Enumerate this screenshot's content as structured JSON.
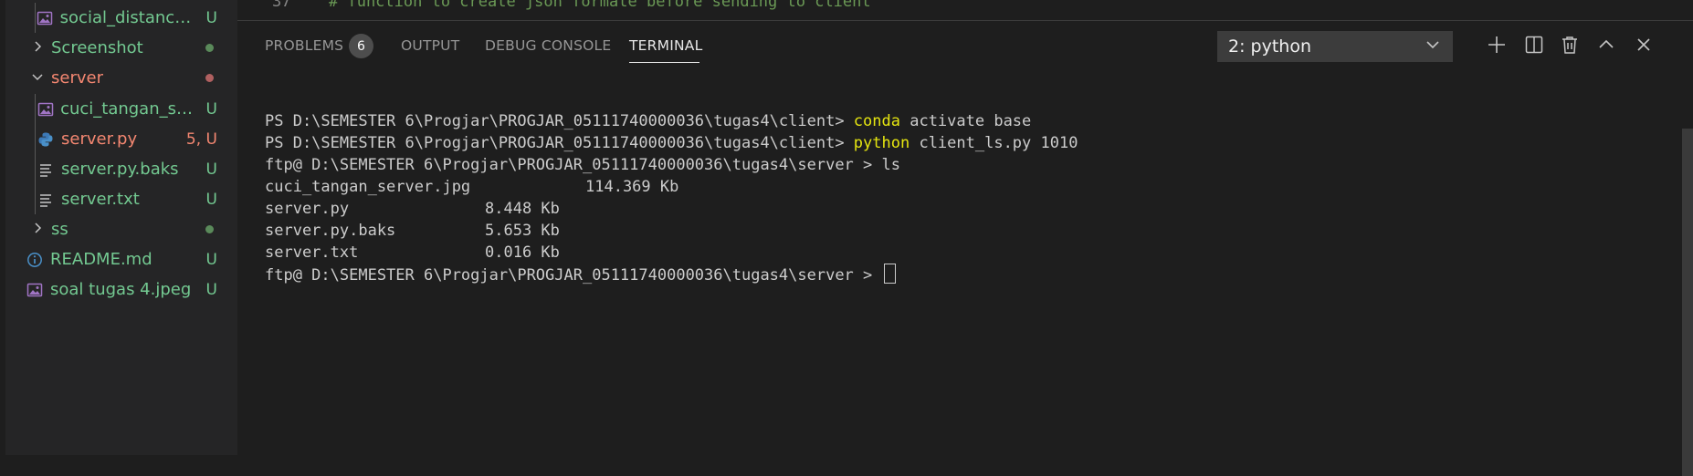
{
  "explorer": {
    "items": [
      {
        "label": "social_distancin...",
        "badge": "U",
        "type": "image",
        "color": "#73c991"
      },
      {
        "label": "Screenshot",
        "badge": "",
        "type": "folder-collapsed",
        "dot": "#5a8a5a",
        "color": "#73c991"
      },
      {
        "label": "server",
        "badge": "",
        "type": "folder-expanded",
        "dot": "#b06060",
        "color": "#f48771"
      },
      {
        "label": "cuci_tangan_se...",
        "badge": "U",
        "type": "image",
        "color": "#73c991"
      },
      {
        "label": "server.py",
        "badge": "5, U",
        "type": "python",
        "color": "#f48771"
      },
      {
        "label": "server.py.baks",
        "badge": "U",
        "type": "text",
        "color": "#73c991"
      },
      {
        "label": "server.txt",
        "badge": "U",
        "type": "text",
        "color": "#73c991"
      },
      {
        "label": "ss",
        "badge": "",
        "type": "folder-collapsed",
        "dot": "#5a8a5a",
        "color": "#73c991"
      },
      {
        "label": "README.md",
        "badge": "U",
        "type": "info",
        "color": "#73c991"
      },
      {
        "label": "soal tugas 4.jpeg",
        "badge": "U",
        "type": "image",
        "color": "#73c991"
      }
    ]
  },
  "editor": {
    "line_number": "37",
    "code": "# function to create json formate before sending to client"
  },
  "panel": {
    "tabs": {
      "problems": "PROBLEMS",
      "problems_count": "6",
      "output": "OUTPUT",
      "debug_console": "DEBUG CONSOLE",
      "terminal": "TERMINAL"
    },
    "terminal_select": "2: python",
    "actions": [
      "plus-icon",
      "split-icon",
      "trash-icon",
      "chevron-up-icon",
      "close-icon"
    ]
  },
  "terminal": {
    "line1_prompt": "PS D:\\SEMESTER 6\\Progjar\\PROGJAR_05111740000036\\tugas4\\client> ",
    "line1_cmd": "conda",
    "line1_args": " activate base",
    "line2_prompt": "PS D:\\SEMESTER 6\\Progjar\\PROGJAR_05111740000036\\tugas4\\client> ",
    "line2_cmd": "python",
    "line2_args": " client_ls.py 1010",
    "line3": "ftp@ D:\\SEMESTER 6\\Progjar\\PROGJAR_05111740000036\\tugas4\\server > ls",
    "files": [
      {
        "name": "cuci_tangan_server.jpg",
        "size": "114.369 Kb"
      },
      {
        "name": "server.py",
        "size": "8.448 Kb"
      },
      {
        "name": "server.py.baks",
        "size": "5.653 Kb"
      },
      {
        "name": "server.txt",
        "size": "0.016 Kb"
      }
    ],
    "last_prompt": "ftp@ D:\\SEMESTER 6\\Progjar\\PROGJAR_05111740000036\\tugas4\\server > "
  }
}
